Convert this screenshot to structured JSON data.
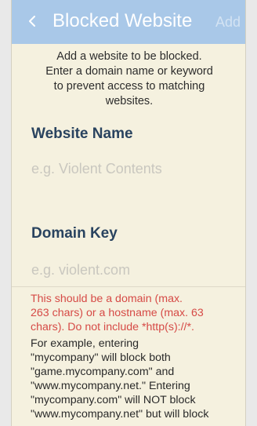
{
  "header": {
    "back_icon": "chevron-left-icon",
    "title": "Blocked Website",
    "add_label": "Add"
  },
  "instructions": {
    "lines": [
      "Add a website to be blocked.",
      "Enter a domain name or keyword",
      "to prevent access to matching",
      "websites."
    ]
  },
  "website_name": {
    "label": "Website Name",
    "value": "",
    "placeholder": "e.g. Violent Contents"
  },
  "domain_key": {
    "label": "Domain Key",
    "value": "",
    "placeholder": "e.g. violent.com"
  },
  "info": {
    "warning_lines": [
      "This should be a domain (max.",
      "263 chars) or a hostname (max. 63",
      "chars). Do not include *http(s)://*."
    ],
    "example_lines": [
      "For example, entering",
      "\"mycompany\" will block both",
      "\"game.mycompany.com\" and",
      "\"www.mycompany.net.\" Entering",
      "\"mycompany.com\" will NOT block",
      "\"www.mycompany.net\" but will block"
    ]
  },
  "colors": {
    "header_background": "#a9c8e8",
    "title_color": "#ffffff",
    "accent_text": "#29435f",
    "warning_text": "#d64a46",
    "page_background": "#f5f1df"
  }
}
